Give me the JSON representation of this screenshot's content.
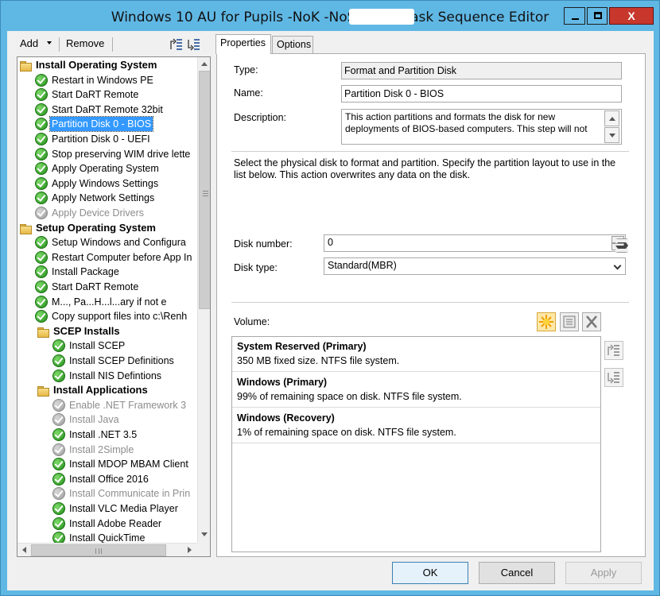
{
  "window": {
    "title": "Windows 10 AU for Pupils -NoK -NoS-RE     11 Task Sequence Editor",
    "controls": {
      "minimize": "_",
      "maximize": "□",
      "close": "X"
    }
  },
  "toolbar": {
    "add_label": "Add",
    "remove_label": "Remove"
  },
  "tree": {
    "items": [
      {
        "label": "Install Operating System",
        "kind": "group"
      },
      {
        "label": "Restart in Windows PE",
        "kind": "ok"
      },
      {
        "label": "Start DaRT Remote",
        "kind": "ok"
      },
      {
        "label": "Start DaRT Remote 32bit",
        "kind": "ok"
      },
      {
        "label": "Partition Disk 0 - BIOS",
        "kind": "ok",
        "selected": true
      },
      {
        "label": "Partition Disk 0 - UEFI",
        "kind": "ok"
      },
      {
        "label": "Stop preserving WIM drive lette",
        "kind": "ok"
      },
      {
        "label": "Apply Operating System",
        "kind": "ok"
      },
      {
        "label": "Apply Windows Settings",
        "kind": "ok"
      },
      {
        "label": "Apply Network Settings",
        "kind": "ok"
      },
      {
        "label": "Apply Device Drivers",
        "kind": "disabled"
      },
      {
        "label": "Setup Operating System",
        "kind": "group"
      },
      {
        "label": "Setup Windows and Configura",
        "kind": "ok"
      },
      {
        "label": "Restart Computer before App In",
        "kind": "ok"
      },
      {
        "label": "Install Package",
        "kind": "ok"
      },
      {
        "label": "Start DaRT Remote",
        "kind": "ok"
      },
      {
        "label": "M..., Pa...H...l...ary if not e",
        "kind": "ok"
      },
      {
        "label": "Copy support files into c:\\Renh",
        "kind": "ok"
      },
      {
        "label": "SCEP Installs",
        "kind": "group",
        "indent": 1
      },
      {
        "label": "Install SCEP",
        "kind": "ok",
        "indent": 1
      },
      {
        "label": "Install SCEP Definitions",
        "kind": "ok",
        "indent": 1
      },
      {
        "label": "Install NIS Defintions",
        "kind": "ok",
        "indent": 1
      },
      {
        "label": "Install Applications",
        "kind": "group",
        "indent": 1
      },
      {
        "label": "Enable .NET Framework 3",
        "kind": "disabled",
        "indent": 1
      },
      {
        "label": "Install Java",
        "kind": "disabled",
        "indent": 1
      },
      {
        "label": "Install .NET 3.5",
        "kind": "ok",
        "indent": 1
      },
      {
        "label": "Install 2Simple",
        "kind": "disabled",
        "indent": 1
      },
      {
        "label": "Install MDOP MBAM Client",
        "kind": "ok",
        "indent": 1
      },
      {
        "label": "Install Office 2016",
        "kind": "ok",
        "indent": 1
      },
      {
        "label": "Install Communicate in Prin",
        "kind": "disabled",
        "indent": 1
      },
      {
        "label": "Install VLC Media Player",
        "kind": "ok",
        "indent": 1
      },
      {
        "label": "Install Adobe Reader",
        "kind": "ok",
        "indent": 1
      },
      {
        "label": "Install QuickTime",
        "kind": "ok",
        "indent": 1
      }
    ]
  },
  "tabs": [
    {
      "label": "Properties",
      "active": true
    },
    {
      "label": "Options",
      "active": false
    }
  ],
  "props": {
    "type_label": "Type:",
    "type_value": "Format and Partition Disk",
    "name_label": "Name:",
    "name_value": "Partition Disk 0 - BIOS",
    "desc_label": "Description:",
    "desc_value": "This action partitions and formats the disk for new deployments of BIOS-based computers. This step will not",
    "instructions": "Select the physical disk to format and partition. Specify the partition layout to use in the list below. This action overwrites any data on the disk.",
    "disk_number_label": "Disk number:",
    "disk_number_value": "0",
    "disk_type_label": "Disk type:",
    "disk_type_value": "Standard(MBR)",
    "volume_label": "Volume:"
  },
  "volumes": [
    {
      "name": "System Reserved (Primary)",
      "desc": "350 MB fixed size. NTFS file system."
    },
    {
      "name": "Windows (Primary)",
      "desc": "99% of remaining space on disk. NTFS file system."
    },
    {
      "name": "Windows (Recovery)",
      "desc": "1% of remaining space on disk. NTFS file system."
    }
  ],
  "buttons": {
    "ok": "OK",
    "cancel": "Cancel",
    "apply": "Apply"
  },
  "colors": {
    "title_bar": "#5fb7e4",
    "close_button": "#c7372c",
    "selection": "#3399ff"
  }
}
